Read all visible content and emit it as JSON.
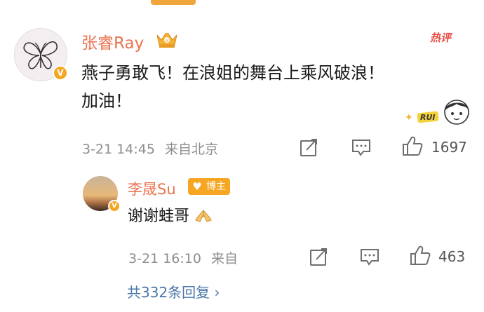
{
  "main_comment": {
    "username": "张睿Ray",
    "hot_label": "热评",
    "text_line1": "燕子勇敢飞！在浪姐的舞台上乘风破浪！",
    "text_line2": "加油！",
    "sticker_text": "RUI",
    "timestamp": "3-21 14:45",
    "location": "来自北京",
    "likes": "1697"
  },
  "reply": {
    "username": "李晟Su",
    "badge": "博主",
    "text": "谢谢蛙哥",
    "timestamp": "3-21 16:10",
    "location": "来自",
    "likes": "463"
  },
  "more_replies": "共332条回复 ›",
  "colors": {
    "username": "#eb7350",
    "meta": "#8e8e8e",
    "link": "#4a75a8",
    "badge": "#f5a623",
    "hot": "#e8483f"
  },
  "icons": [
    "share-icon",
    "comment-icon",
    "like-icon",
    "verified-icon",
    "crown-icon",
    "heart-badge-icon",
    "pray-hands-emoji",
    "chevron-right-icon"
  ]
}
